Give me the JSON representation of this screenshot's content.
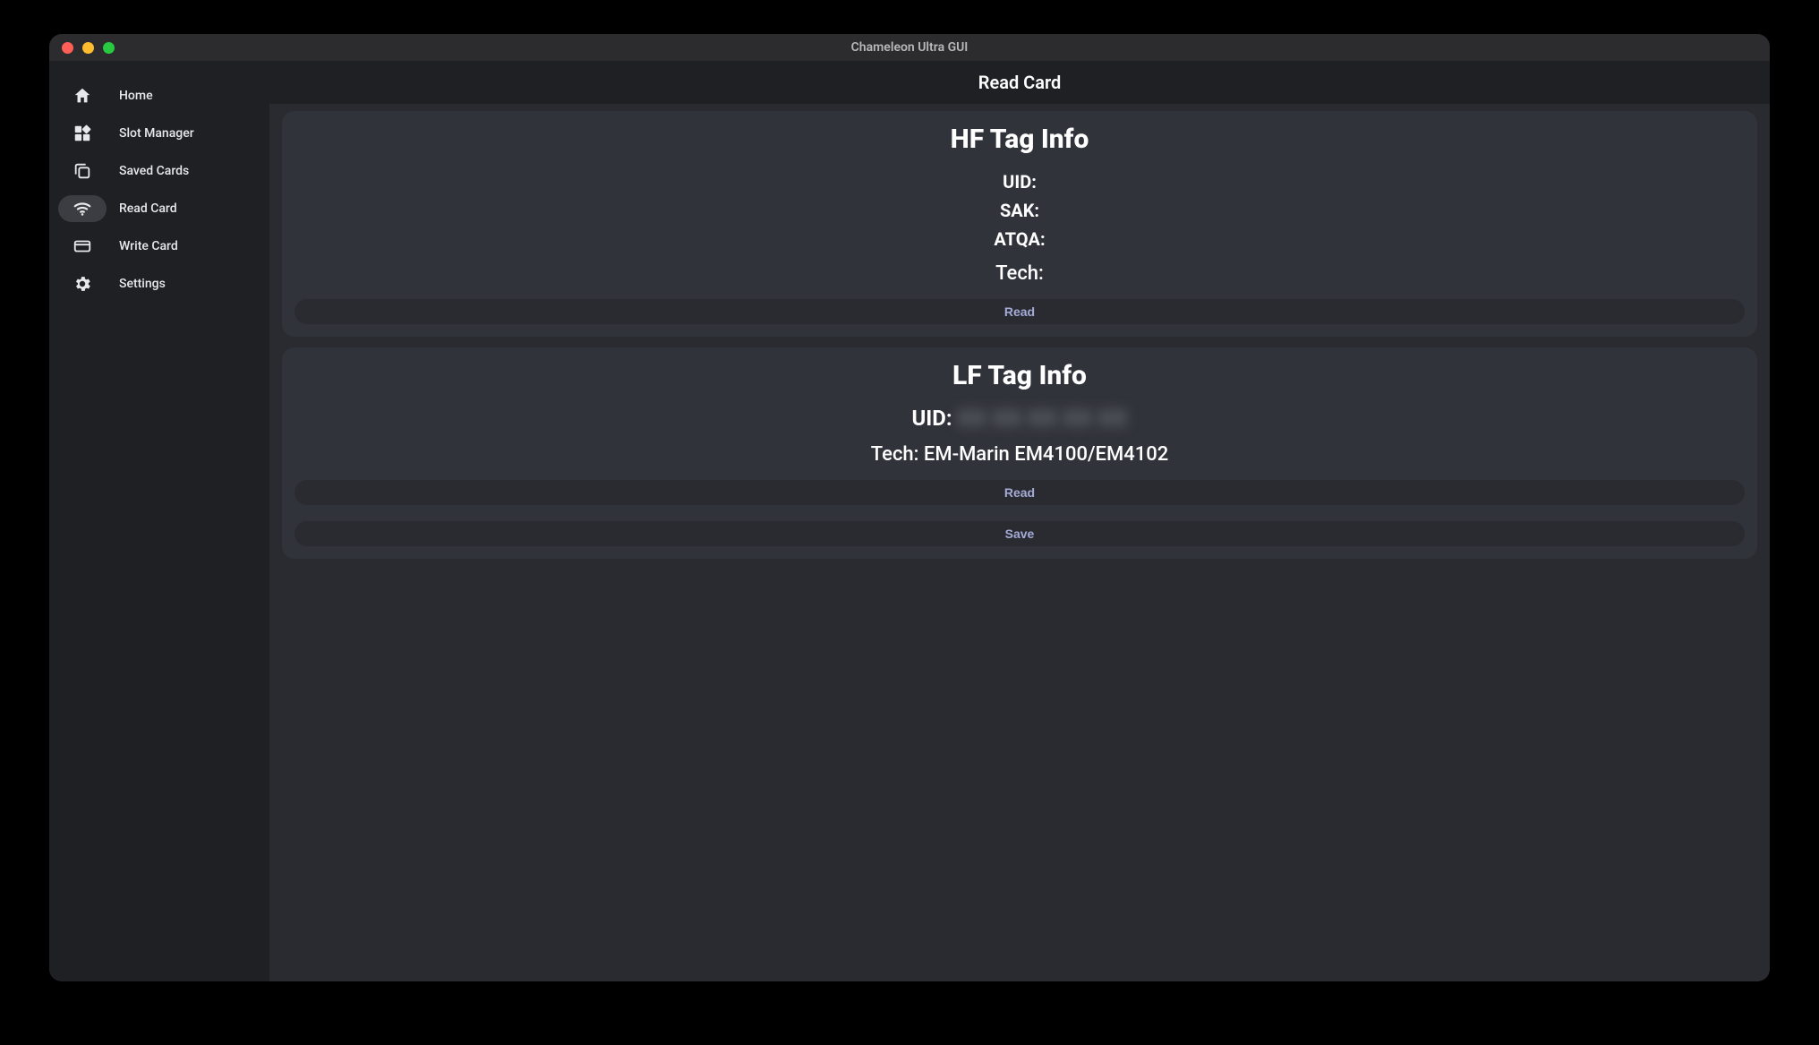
{
  "window": {
    "title": "Chameleon Ultra GUI"
  },
  "sidebar": {
    "items": [
      {
        "label": "Home"
      },
      {
        "label": "Slot Manager"
      },
      {
        "label": "Saved Cards"
      },
      {
        "label": "Read Card"
      },
      {
        "label": "Write Card"
      },
      {
        "label": "Settings"
      }
    ]
  },
  "page": {
    "title": "Read Card"
  },
  "hf": {
    "heading": "HF Tag Info",
    "uid_label": "UID:",
    "sak_label": "SAK:",
    "atqa_label": "ATQA:",
    "tech_label": "Tech:",
    "read_label": "Read"
  },
  "lf": {
    "heading": "LF Tag Info",
    "uid_label": "UID:",
    "uid_value_masked": "XX XX XX XX XX",
    "tech_line": "Tech: EM-Marin EM4100/EM4102",
    "read_label": "Read",
    "save_label": "Save"
  }
}
